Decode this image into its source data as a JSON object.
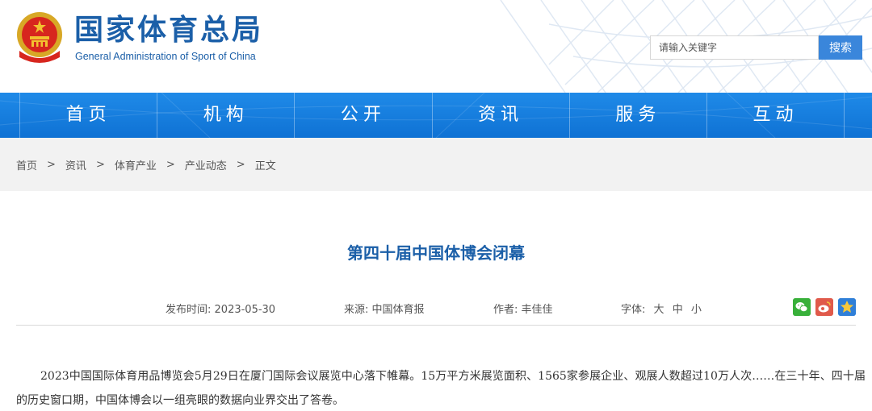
{
  "site": {
    "title_cn": "国家体育总局",
    "title_en": "General Administration of Sport of China"
  },
  "search": {
    "placeholder": "请输入关键字",
    "button_label": "搜索"
  },
  "nav": {
    "items": [
      {
        "label": "首页"
      },
      {
        "label": "机构"
      },
      {
        "label": "公开"
      },
      {
        "label": "资讯"
      },
      {
        "label": "服务"
      },
      {
        "label": "互动"
      }
    ]
  },
  "breadcrumb": {
    "separator": ">",
    "items": [
      {
        "label": "首页"
      },
      {
        "label": "资讯"
      },
      {
        "label": "体育产业"
      },
      {
        "label": "产业动态"
      },
      {
        "label": "正文"
      }
    ]
  },
  "article": {
    "title": "第四十届中国体博会闭幕",
    "meta": {
      "date_label": "发布时间:",
      "date": "2023-05-30",
      "source_label": "来源:",
      "source": "中国体育报",
      "author_label": "作者:",
      "author": "丰佳佳",
      "font_label": "字体:",
      "font_large": "大",
      "font_medium": "中",
      "font_small": "小"
    },
    "share_icons": [
      "wechat-icon",
      "weibo-icon",
      "star-icon"
    ],
    "body": "2023中国国际体育用品博览会5月29日在厦门国际会议展览中心落下帷幕。15万平方米展览面积、1565家参展企业、观展人数超过10万人次……在三十年、四十届的历史窗口期，中国体博会以一组亮眼的数据向业界交出了答卷。"
  },
  "colors": {
    "brand_blue": "#1b5fa8",
    "nav_blue": "#1580e0",
    "search_button": "#3a86db",
    "wechat_green": "#38b03a",
    "weibo_red": "#e05a4b",
    "star_blue": "#2f7fd8"
  }
}
